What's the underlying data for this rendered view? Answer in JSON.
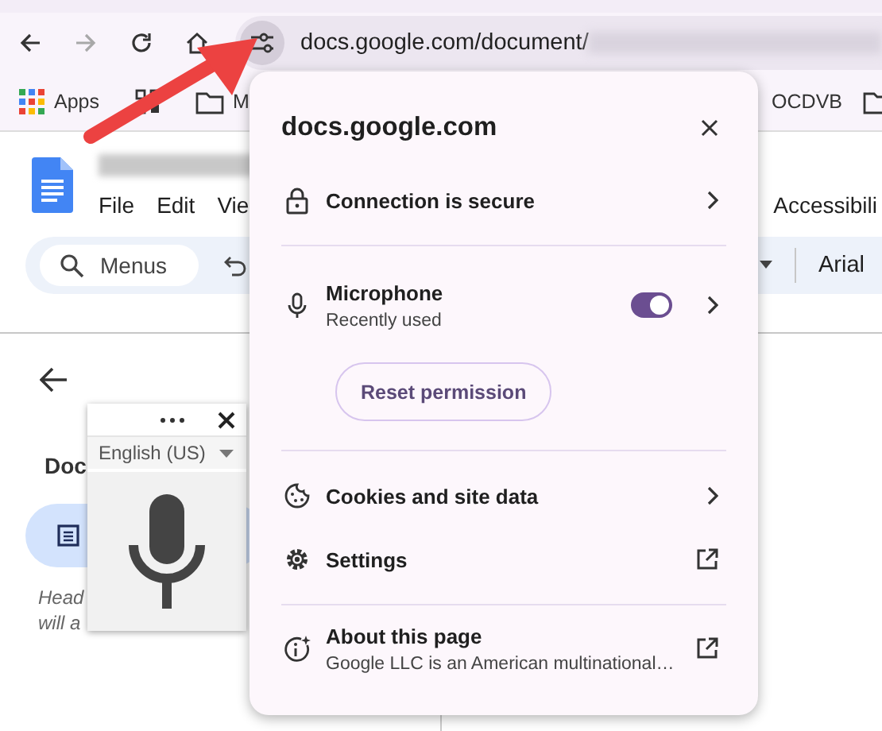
{
  "browser": {
    "nav": [
      {
        "kind": "back",
        "disabled": false
      },
      {
        "kind": "forward",
        "disabled": true
      },
      {
        "kind": "reload",
        "disabled": false
      },
      {
        "kind": "home",
        "disabled": false
      }
    ],
    "address": {
      "url": "docs.google.com/document/"
    },
    "bookmarks_left": [
      {
        "kind": "apps",
        "label": "Apps"
      },
      {
        "kind": "grid"
      },
      {
        "kind": "folder",
        "label": "M"
      }
    ],
    "bookmarks_right": [
      {
        "kind": "text",
        "label": "OCDVB"
      },
      {
        "kind": "folder"
      }
    ]
  },
  "docs": {
    "menus": [
      "File",
      "Edit",
      "Vie"
    ],
    "right_menu": "Accessibili",
    "search": {
      "placeholder": "Menus"
    },
    "font": "Arial"
  },
  "sidebar": {
    "heading": "Doc",
    "tab_selected": true,
    "hint_lines": [
      "Head",
      "will a"
    ]
  },
  "voice_typing": {
    "language": "English (US)"
  },
  "site_info": {
    "title": "docs.google.com",
    "sections": [
      [
        {
          "kind": "connection",
          "label": "Connection is secure"
        }
      ],
      [
        {
          "kind": "permission",
          "label": "Microphone",
          "sublabel": "Recently used",
          "on": true,
          "action": "Reset permission"
        }
      ],
      [
        {
          "kind": "cookies",
          "label": "Cookies and site data"
        },
        {
          "kind": "settings",
          "label": "Settings"
        }
      ],
      [
        {
          "kind": "about",
          "label": "About this page",
          "sublabel": "Google LLC is an American multinational…"
        }
      ]
    ]
  }
}
